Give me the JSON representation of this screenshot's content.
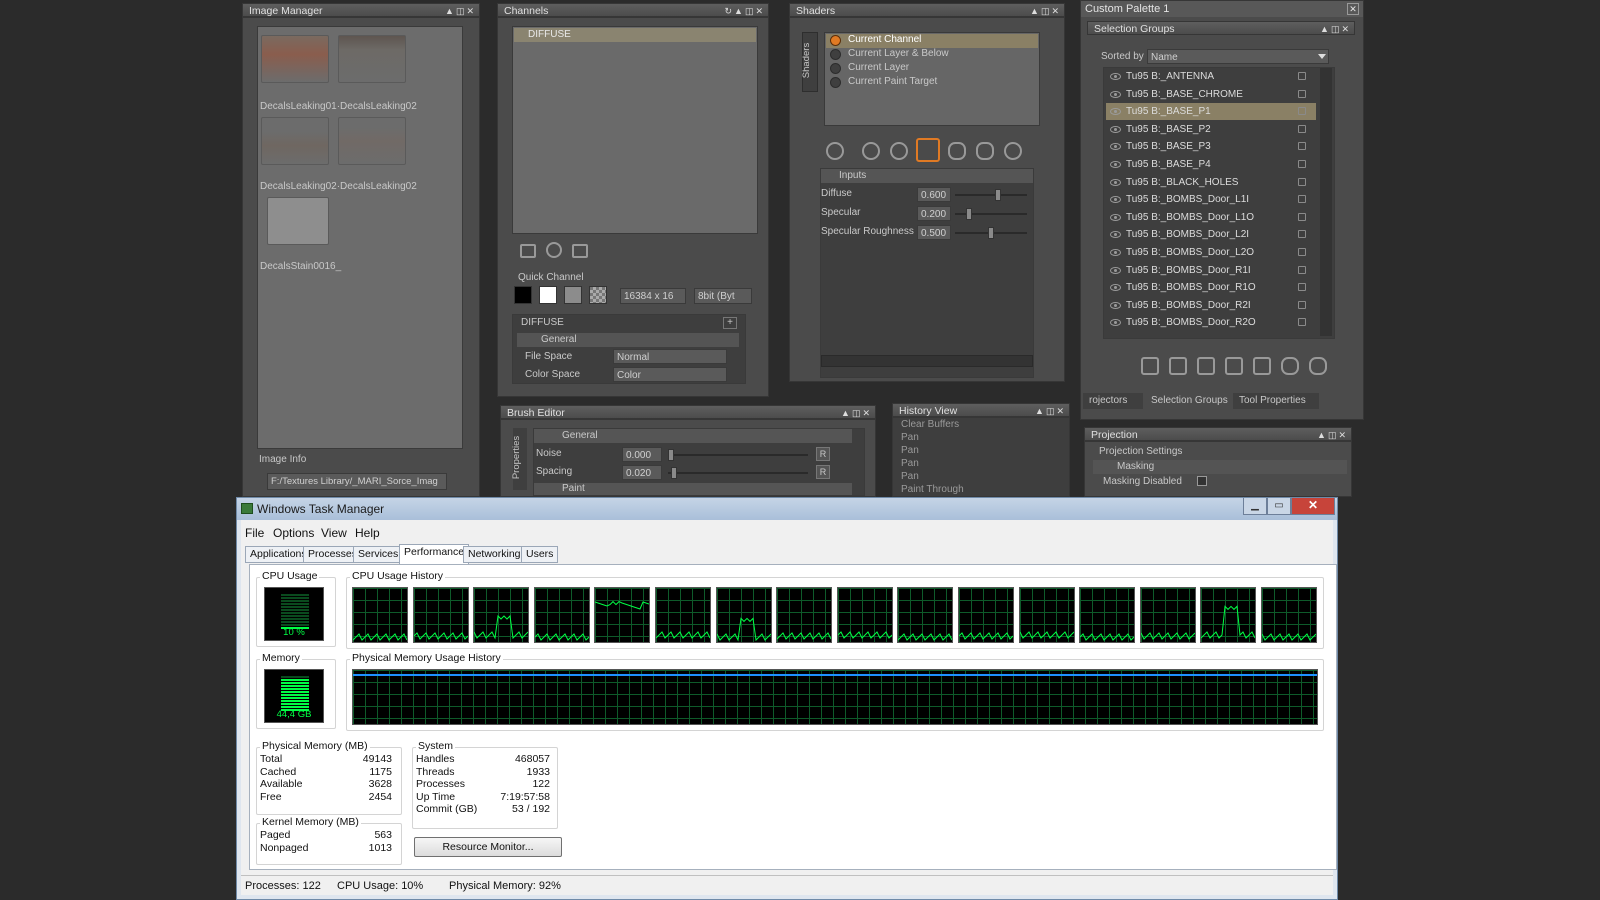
{
  "image_manager": {
    "title": "Image Manager",
    "thumbs": [
      "DecalsLeaking01·DecalsLeaking02",
      "DecalsLeaking02·DecalsLeaking02",
      "DecalsStain0016_"
    ],
    "image_info_label": "Image Info",
    "path": "F:/Textures Library/_MARI_Sorce_Imag"
  },
  "channels": {
    "title": "Channels",
    "channel_name": "DIFFUSE",
    "quick_channel_label": "Quick Channel",
    "size_value": "16384 x 16",
    "depth_value": "8bit (Byt",
    "props_title": "DIFFUSE",
    "general_label": "General",
    "file_space_label": "File Space",
    "file_space_value": "Normal",
    "color_space_label": "Color Space",
    "color_space_value": "Color"
  },
  "shaders": {
    "title": "Shaders",
    "side_tab": "Shaders",
    "options": [
      "Current Channel",
      "Current Layer & Below",
      "Current Layer",
      "Current Paint Target"
    ],
    "inputs_label": "Inputs",
    "params": [
      {
        "label": "Diffuse",
        "value": "0.600"
      },
      {
        "label": "Specular",
        "value": "0.200"
      },
      {
        "label": "Specular Roughness",
        "value": "0.500"
      }
    ]
  },
  "palette": {
    "title": "Custom Palette 1",
    "sel_groups_title": "Selection Groups",
    "sorted_by_label": "Sorted by",
    "sorted_by_value": "Name",
    "groups": [
      "Tu95 B:_ANTENNA",
      "Tu95 B:_BASE_CHROME",
      "Tu95 B:_BASE_P1",
      "Tu95 B:_BASE_P2",
      "Tu95 B:_BASE_P3",
      "Tu95 B:_BASE_P4",
      "Tu95 B:_BLACK_HOLES",
      "Tu95 B:_BOMBS_Door_L1I",
      "Tu95 B:_BOMBS_Door_L1O",
      "Tu95 B:_BOMBS_Door_L2I",
      "Tu95 B:_BOMBS_Door_L2O",
      "Tu95 B:_BOMBS_Door_R1I",
      "Tu95 B:_BOMBS_Door_R1O",
      "Tu95 B:_BOMBS_Door_R2I",
      "Tu95 B:_BOMBS_Door_R2O"
    ],
    "tabs": [
      "rojectors",
      "Selection Groups",
      "Tool Properties"
    ]
  },
  "projection": {
    "title": "Projection",
    "settings_label": "Projection Settings",
    "masking_label": "Masking",
    "masking_disabled_label": "Masking Disabled"
  },
  "brush_editor": {
    "title": "Brush Editor",
    "side_tab": "Properties",
    "general_label": "General",
    "params": [
      {
        "label": "Noise",
        "value": "0.000"
      },
      {
        "label": "Spacing",
        "value": "0.020"
      }
    ],
    "paint_label": "Paint"
  },
  "history": {
    "title": "History View",
    "items": [
      "Clear Buffers",
      "Pan",
      "Pan",
      "Pan",
      "Pan",
      "Paint Through"
    ]
  },
  "task_manager": {
    "title": "Windows Task Manager",
    "menu": [
      "File",
      "Options",
      "View",
      "Help"
    ],
    "tabs": [
      "Applications",
      "Processes",
      "Services",
      "Performance",
      "Networking",
      "Users"
    ],
    "cpu_usage_label": "CPU Usage",
    "cpu_usage_value": "10 %",
    "cpu_history_label": "CPU Usage History",
    "memory_label": "Memory",
    "memory_value": "44,4 GB",
    "mem_history_label": "Physical Memory Usage History",
    "physical_memory": {
      "title": "Physical Memory (MB)",
      "rows": [
        [
          "Total",
          "49143"
        ],
        [
          "Cached",
          "1175"
        ],
        [
          "Available",
          "3628"
        ],
        [
          "Free",
          "2454"
        ]
      ]
    },
    "kernel_memory": {
      "title": "Kernel Memory (MB)",
      "rows": [
        [
          "Paged",
          "563"
        ],
        [
          "Nonpaged",
          "1013"
        ]
      ]
    },
    "system": {
      "title": "System",
      "rows": [
        [
          "Handles",
          "468057"
        ],
        [
          "Threads",
          "1933"
        ],
        [
          "Processes",
          "122"
        ],
        [
          "Up Time",
          "7:19:57:58"
        ],
        [
          "Commit (GB)",
          "53 / 192"
        ]
      ]
    },
    "resource_monitor_label": "Resource Monitor...",
    "status": {
      "processes": "Processes: 122",
      "cpu": "CPU Usage: 10%",
      "memory": "Physical Memory: 92%"
    },
    "cpu_fraction": 0.1,
    "memory_fraction": 0.92
  },
  "colors": {
    "accent_orange": "#e07a24",
    "graph_green": "#00ff44",
    "selection_highlight": "#8a8065"
  }
}
